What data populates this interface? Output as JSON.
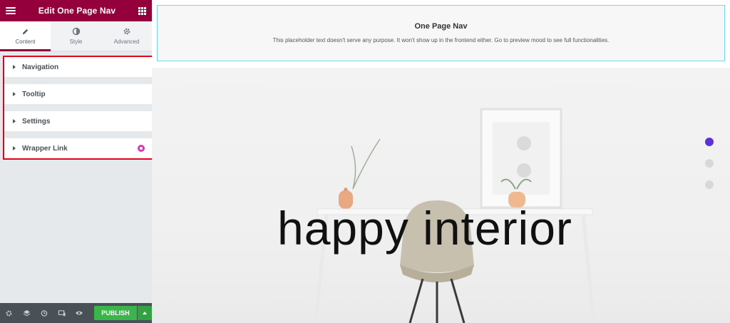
{
  "editor": {
    "title": "Edit One Page Nav",
    "tabs": [
      {
        "label": "Content",
        "icon": "pencil-icon",
        "active": true
      },
      {
        "label": "Style",
        "icon": "half-circle-icon",
        "active": false
      },
      {
        "label": "Advanced",
        "icon": "gear-icon",
        "active": false
      }
    ],
    "sections": [
      {
        "label": "Navigation"
      },
      {
        "label": "Tooltip"
      },
      {
        "label": "Settings"
      },
      {
        "label": "Wrapper Link",
        "badge_icon": "pro-icon"
      }
    ],
    "footer": {
      "publish_label": "PUBLISH",
      "icons": [
        "settings-icon",
        "layers-icon",
        "history-icon",
        "responsive-icon",
        "preview-eye-icon"
      ]
    }
  },
  "canvas": {
    "placeholder": {
      "title": "One Page Nav",
      "text": "This placeholder text doesn't serve any purpose. It won't show up in the frontend either. Go to preview mood to see full functionalities."
    },
    "headline": "happy interior",
    "nav_dots": {
      "count": 3,
      "active_index": 0
    }
  },
  "colors": {
    "brand": "#93003c",
    "highlight_border": "#e4001b",
    "publish": "#39b54a",
    "active_dot": "#5d31d8",
    "pro_badge": "#d63cb0"
  }
}
